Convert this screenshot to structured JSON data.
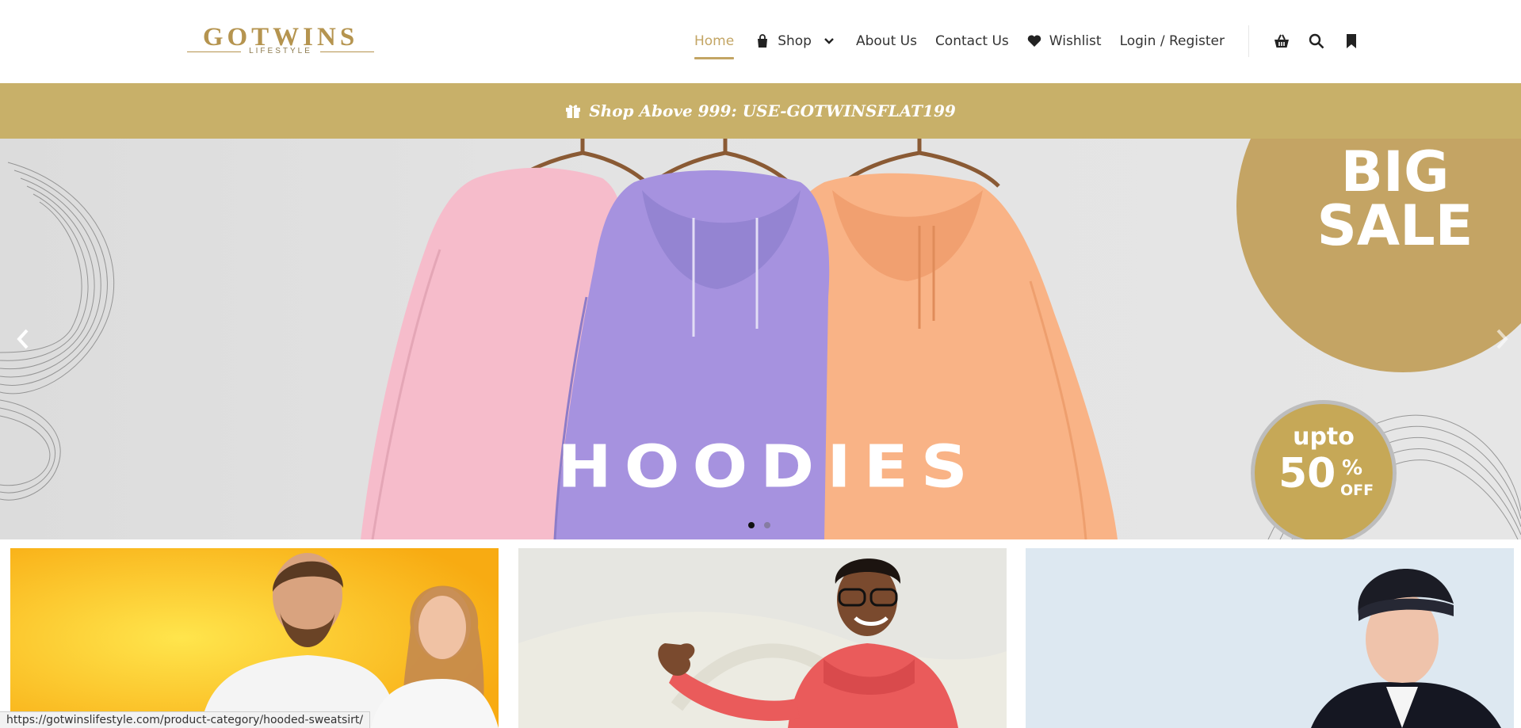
{
  "brand": {
    "name": "GOTWINS",
    "tagline": "LIFESTYLE",
    "color": "#b5944f"
  },
  "nav": {
    "items": [
      {
        "label": "Home",
        "active": true
      },
      {
        "label": "Shop",
        "icon": "shopping-bag-icon",
        "has_dropdown": true
      },
      {
        "label": "About Us"
      },
      {
        "label": "Contact Us"
      },
      {
        "label": "Wishlist",
        "icon": "heart-icon"
      },
      {
        "label": "Login / Register"
      }
    ],
    "tools": [
      "basket-icon",
      "search-icon",
      "bookmark-icon"
    ],
    "accent": "#c3a564"
  },
  "promo": {
    "icon": "gift-icon",
    "text": "Shop Above 999: USE-GOTWINSFLAT199",
    "background": "#c8b069"
  },
  "hero": {
    "headline": "HOODIES",
    "sale_line1": "BIG",
    "sale_line2": "SALE",
    "badge_upto": "upto",
    "badge_value": "50",
    "badge_percent": "%",
    "badge_off": "OFF",
    "slides": 2,
    "active_slide": 1
  },
  "tiles": [
    {
      "name": "t-shirts-tile",
      "background": "#fbbd1c"
    },
    {
      "name": "hoodies-tile",
      "background": "#e4e4de"
    },
    {
      "name": "jackets-tile",
      "background": "#dce7f0"
    }
  ],
  "status_bar": {
    "url": "https://gotwinslifestyle.com/product-category/hooded-sweatsirt/"
  }
}
